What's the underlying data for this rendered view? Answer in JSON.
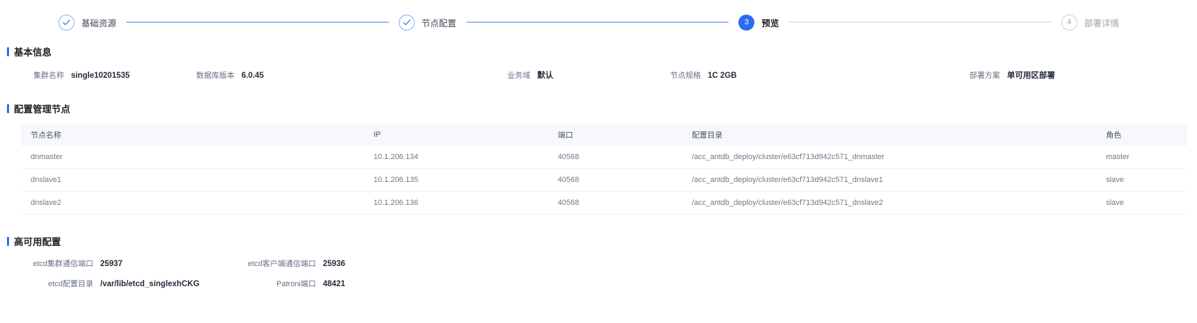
{
  "colors": {
    "accent": "#2b6cf0",
    "connector_done": "#9ab9f8",
    "connector_pending": "#e2e4e9",
    "table_header_bg": "#f7f8fb"
  },
  "steps": [
    {
      "label": "基础资源",
      "status": "done"
    },
    {
      "label": "节点配置",
      "status": "done"
    },
    {
      "label": "预览",
      "status": "active",
      "number": "3"
    },
    {
      "label": "部署详情",
      "status": "pending",
      "number": "4"
    }
  ],
  "basic_info": {
    "title": "基本信息",
    "fields": [
      {
        "label": "集群名称",
        "value": "single10201535"
      },
      {
        "label": "数据库版本",
        "value": "6.0.45"
      },
      {
        "label": "业务域",
        "value": "默认"
      },
      {
        "label": "节点规格",
        "value": "1C 2GB"
      },
      {
        "label": "部署方案",
        "value": "单可用区部署"
      }
    ]
  },
  "nodes_table": {
    "title": "配置管理节点",
    "columns": [
      "节点名称",
      "IP",
      "端口",
      "配置目录",
      "角色"
    ],
    "rows": [
      [
        "dnmaster",
        "10.1.206.134",
        "40568",
        "/acc_antdb_deploy/cluster/e63cf713d942c571_dnmaster",
        "master"
      ],
      [
        "dnslave1",
        "10.1.206.135",
        "40568",
        "/acc_antdb_deploy/cluster/e63cf713d942c571_dnslave1",
        "slave"
      ],
      [
        "dnslave2",
        "10.1.206.136",
        "40568",
        "/acc_antdb_deploy/cluster/e63cf713d942c571_dnslave2",
        "slave"
      ]
    ]
  },
  "ha_config": {
    "title": "高可用配置",
    "fields": [
      {
        "label": "etcd集群通信端口",
        "value": "25937"
      },
      {
        "label": "etcd客户端通信端口",
        "value": "25936"
      },
      {
        "label": "etcd配置目录",
        "value": "/var/lib/etcd_singlexhCKG"
      },
      {
        "label": "Patroni端口",
        "value": "48421"
      }
    ]
  }
}
